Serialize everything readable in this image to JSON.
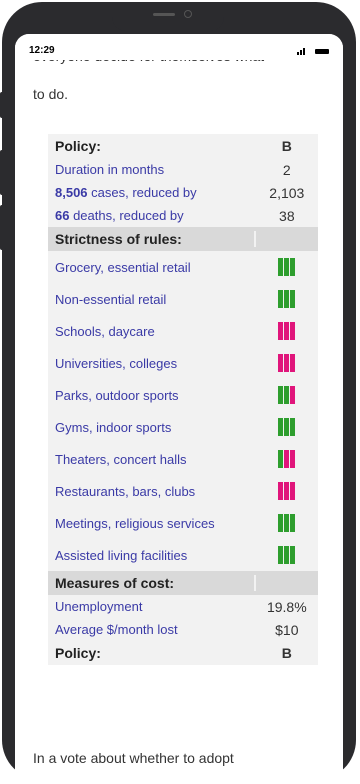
{
  "status_bar": {
    "time": "12:29"
  },
  "intro": {
    "partial_line": "everyone decide for themselves what",
    "line": "to do."
  },
  "colors": {
    "green": "#2e9e2e",
    "magenta": "#e0157b"
  },
  "table": {
    "policy_label": "Policy:",
    "policy_value": "B",
    "duration_label": "Duration in months",
    "duration_value": "2",
    "cases_count": "8,506",
    "cases_text": " cases, reduced by",
    "cases_value": "2,103",
    "deaths_count": "66",
    "deaths_text": " deaths, reduced by",
    "deaths_value": "38",
    "strictness_header": "Strictness of rules:",
    "rules": [
      {
        "label": "Grocery, essential retail",
        "bars": [
          "green",
          "green",
          "green"
        ]
      },
      {
        "label": "Non-essential retail",
        "bars": [
          "green",
          "green",
          "green"
        ]
      },
      {
        "label": "Schools, daycare",
        "bars": [
          "magenta",
          "magenta",
          "magenta"
        ]
      },
      {
        "label": "Universities, colleges",
        "bars": [
          "magenta",
          "magenta",
          "magenta"
        ]
      },
      {
        "label": "Parks, outdoor sports",
        "bars": [
          "green",
          "green",
          "magenta"
        ]
      },
      {
        "label": "Gyms, indoor sports",
        "bars": [
          "green",
          "green",
          "green"
        ]
      },
      {
        "label": "Theaters, concert halls",
        "bars": [
          "green",
          "magenta",
          "magenta"
        ]
      },
      {
        "label": "Restaurants, bars, clubs",
        "bars": [
          "magenta",
          "magenta",
          "magenta"
        ]
      },
      {
        "label": "Meetings, religious services",
        "bars": [
          "green",
          "green",
          "green"
        ]
      },
      {
        "label": "Assisted living facilities",
        "bars": [
          "green",
          "green",
          "green"
        ]
      }
    ],
    "cost_header": "Measures of cost:",
    "unemployment_label": "Unemployment",
    "unemployment_value": "19.8%",
    "money_label": "Average $/month lost",
    "money_value": "$10",
    "policy_footer_label": "Policy:",
    "policy_footer_value": "B"
  },
  "bottom_text": "In a vote about whether to adopt"
}
